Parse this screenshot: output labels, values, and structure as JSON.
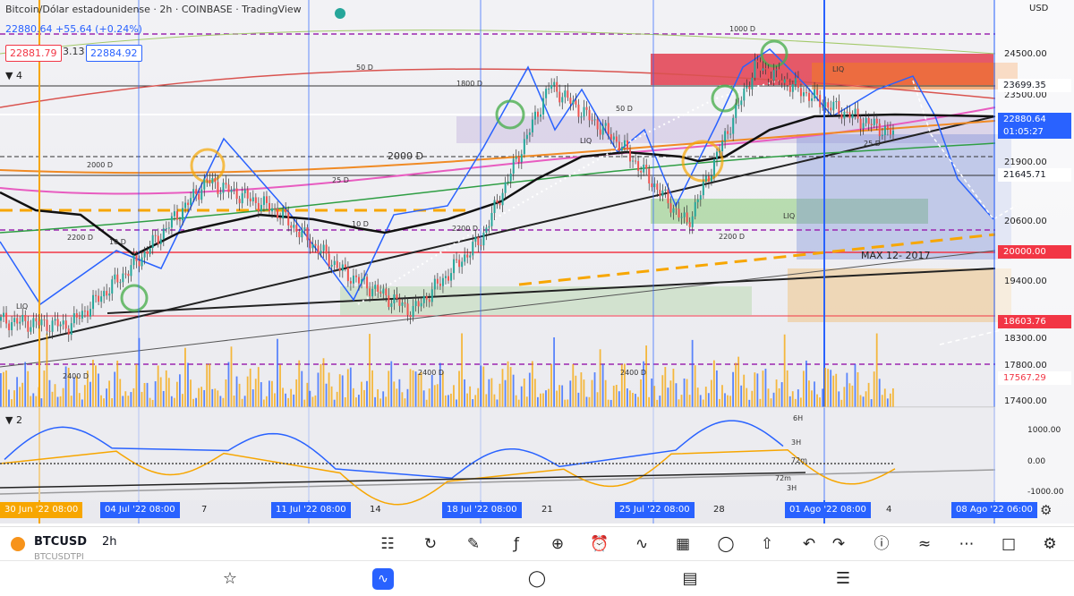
{
  "header": {
    "title": "Bitcoin/Dólar estadounidense · 2h · COINBASE · TradingView",
    "ohlc_line": "22880.64 +55.64 (+0.24%)",
    "sell_price": "22881.79",
    "spread": "3.13",
    "buy_price": "22884.92",
    "indicator_count": "4",
    "currency": "USD"
  },
  "oscillator": {
    "panel_count": "2",
    "ticks": [
      "1000.00",
      "0.00",
      "-1000.00"
    ],
    "labels": [
      "6H",
      "3H",
      "72m",
      "72m",
      "3H"
    ]
  },
  "price_axis": {
    "ticks": [
      "24500.00",
      "23500.00",
      "21900.00",
      "20600.00",
      "19400.00",
      "18300.00",
      "17800.00",
      "17400.00"
    ],
    "labels": [
      {
        "text": "23699.35",
        "color": "#131722",
        "bg": "#ffffff"
      },
      {
        "text": "22880.64",
        "color": "#ffffff",
        "bg": "#2962ff"
      },
      {
        "text": "01:05:27",
        "color": "#ffffff",
        "bg": "#2962ff"
      },
      {
        "text": "21645.71",
        "color": "#131722",
        "bg": "#ffffff"
      },
      {
        "text": "20000.00",
        "color": "#ffffff",
        "bg": "#f23645"
      },
      {
        "text": "18603.76",
        "color": "#ffffff",
        "bg": "#f23645"
      },
      {
        "text": "17567.29",
        "color": "#f23645",
        "bg": "#ffffff"
      }
    ]
  },
  "time_axis": {
    "labels": [
      "30 Jun '22  08:00",
      "04 Jul '22  08:00",
      "11 Jul '22  08:00",
      "18 Jul '22  08:00",
      "25 Jul '22  08:00",
      "01 Ago '22  08:00",
      "08 Ago '22  06:00"
    ],
    "ticks": [
      "7",
      "14",
      "21",
      "28",
      "4"
    ]
  },
  "annotations": [
    "2000 D",
    "2000 D",
    "1800 D",
    "1000 D",
    "50 D",
    "50 D",
    "25 D",
    "25 D",
    "10 D",
    "10 D",
    "2200 D",
    "2200 D",
    "2200 D",
    "2400 D",
    "2400 D",
    "2400 D",
    "MAX 12- 2017",
    "LIQ"
  ],
  "symbol_bar": {
    "symbol": "BTCUSD",
    "interval": "2h",
    "sub_symbol": "BTCUSDTPI",
    "icons": [
      "candles-icon",
      "replay-icon",
      "brush-icon",
      "formula-icon",
      "crosshair-icon",
      "alarm-icon",
      "indicators-icon",
      "grid-icon",
      "idea-icon",
      "share-icon",
      "undo-icon",
      "redo-icon",
      "info-icon",
      "compare-icon",
      "more-icon",
      "fullscreen-icon",
      "settings-icon"
    ]
  },
  "bottom_nav": {
    "icons": [
      "watchlist-icon",
      "chart-icon",
      "explore-icon",
      "news-icon",
      "menu-icon"
    ]
  },
  "colors": {
    "blue": "#2962ff",
    "orange": "#f7a600",
    "red": "#f23645",
    "purple": "#9c27b0"
  },
  "chart_data": {
    "type": "line",
    "title": "Bitcoin/Dólar estadounidense · 2h · COINBASE",
    "x_labels": [
      "30 Jun '22",
      "04 Jul '22",
      "11 Jul '22",
      "18 Jul '22",
      "25 Jul '22",
      "01 Ago '22",
      "08 Ago '22"
    ],
    "series": [
      {
        "name": "BTCUSD",
        "values": [
          19000,
          18900,
          20250,
          21900,
          21300,
          20000,
          19200,
          20700,
          23900,
          22700,
          21000,
          24300,
          23500,
          22880
        ]
      }
    ],
    "ylim": [
      17300,
      25100
    ],
    "grid": false
  }
}
